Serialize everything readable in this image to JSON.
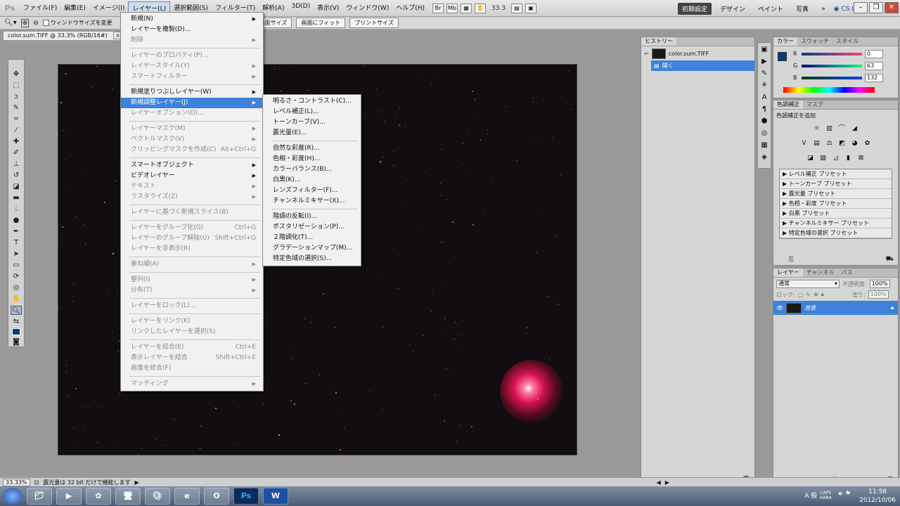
{
  "app": {
    "logo": "Ps",
    "menus": [
      "ファイル(F)",
      "編集(E)",
      "イメージ(I)",
      "レイヤー(L)",
      "選択範囲(S)",
      "フィルター(T)",
      "解析(A)",
      "3D(D)",
      "表示(V)",
      "ウィンドウ(W)",
      "ヘルプ(H)"
    ],
    "active_menu_index": 3,
    "menubar_icons": [
      "Br",
      "Mb"
    ],
    "zoom": "33.3",
    "workspaces": [
      "初期設定",
      "デザイン",
      "ペイント",
      "写真"
    ],
    "more": "»",
    "cs_live": "CS Live"
  },
  "options_bar": {
    "checkbox1": "ウィンドウサイズを変更",
    "buttons": [
      "画面サイズ",
      "画面にフィット",
      "プリントサイズ"
    ]
  },
  "document": {
    "tab_title": "color.sum.TIFF @ 33.3% (RGB/16#)",
    "close": "×"
  },
  "layer_menu": {
    "items": [
      {
        "label": "新規(N)",
        "shortcut": "",
        "submenu": true,
        "disabled": false
      },
      {
        "label": "レイヤーを複製(D)...",
        "shortcut": "",
        "submenu": false,
        "disabled": false
      },
      {
        "label": "削除",
        "shortcut": "",
        "submenu": true,
        "disabled": true
      },
      {
        "sep": true
      },
      {
        "label": "レイヤーのプロパティ(P)...",
        "shortcut": "",
        "submenu": false,
        "disabled": true
      },
      {
        "label": "レイヤースタイル(Y)",
        "shortcut": "",
        "submenu": true,
        "disabled": true
      },
      {
        "label": "スマートフィルター",
        "shortcut": "",
        "submenu": true,
        "disabled": true
      },
      {
        "sep": true
      },
      {
        "label": "新規塗りつぶしレイヤー(W)",
        "shortcut": "",
        "submenu": true,
        "disabled": false
      },
      {
        "label": "新規調整レイヤー(J)",
        "shortcut": "",
        "submenu": true,
        "disabled": false,
        "highlight": true
      },
      {
        "label": "レイヤーオプション(O)...",
        "shortcut": "",
        "submenu": false,
        "disabled": true
      },
      {
        "sep": true
      },
      {
        "label": "レイヤーマスク(M)",
        "shortcut": "",
        "submenu": true,
        "disabled": true
      },
      {
        "label": "ベクトルマスク(V)",
        "shortcut": "",
        "submenu": true,
        "disabled": true
      },
      {
        "label": "クリッピングマスクを作成(C)",
        "shortcut": "Alt+Ctrl+G",
        "submenu": false,
        "disabled": true
      },
      {
        "sep": true
      },
      {
        "label": "スマートオブジェクト",
        "shortcut": "",
        "submenu": true,
        "disabled": false
      },
      {
        "label": "ビデオレイヤー",
        "shortcut": "",
        "submenu": true,
        "disabled": false
      },
      {
        "label": "テキスト",
        "shortcut": "",
        "submenu": true,
        "disabled": true
      },
      {
        "label": "ラスタライズ(Z)",
        "shortcut": "",
        "submenu": true,
        "disabled": true
      },
      {
        "sep": true
      },
      {
        "label": "レイヤーに基づく新規スライス(B)",
        "shortcut": "",
        "submenu": false,
        "disabled": true
      },
      {
        "sep": true
      },
      {
        "label": "レイヤーをグループ化(G)",
        "shortcut": "Ctrl+G",
        "submenu": false,
        "disabled": true
      },
      {
        "label": "レイヤーのグループ解除(U)",
        "shortcut": "Shift+Ctrl+G",
        "submenu": false,
        "disabled": true
      },
      {
        "label": "レイヤーを非表示(R)",
        "shortcut": "",
        "submenu": false,
        "disabled": true
      },
      {
        "sep": true
      },
      {
        "label": "重ね順(A)",
        "shortcut": "",
        "submenu": true,
        "disabled": true
      },
      {
        "sep": true
      },
      {
        "label": "整列(I)",
        "shortcut": "",
        "submenu": true,
        "disabled": true
      },
      {
        "label": "分布(T)",
        "shortcut": "",
        "submenu": true,
        "disabled": true
      },
      {
        "sep": true
      },
      {
        "label": "レイヤーをロック(L)...",
        "shortcut": "",
        "submenu": false,
        "disabled": true
      },
      {
        "sep": true
      },
      {
        "label": "レイヤーをリンク(K)",
        "shortcut": "",
        "submenu": false,
        "disabled": true
      },
      {
        "label": "リンクしたレイヤーを選択(S)",
        "shortcut": "",
        "submenu": false,
        "disabled": true
      },
      {
        "sep": true
      },
      {
        "label": "レイヤーを結合(E)",
        "shortcut": "Ctrl+E",
        "submenu": false,
        "disabled": true
      },
      {
        "label": "表示レイヤーを結合",
        "shortcut": "Shift+Ctrl+E",
        "submenu": false,
        "disabled": true
      },
      {
        "label": "画像を統合(F)",
        "shortcut": "",
        "submenu": false,
        "disabled": true
      },
      {
        "sep": true
      },
      {
        "label": "マッティング",
        "shortcut": "",
        "submenu": true,
        "disabled": true
      }
    ]
  },
  "adjust_submenu": {
    "items": [
      {
        "label": "明るさ・コントラスト(C)..."
      },
      {
        "label": "レベル補正(L)..."
      },
      {
        "label": "トーンカーブ(V)..."
      },
      {
        "label": "露光量(E)..."
      },
      {
        "sep": true
      },
      {
        "label": "自然な彩度(R)..."
      },
      {
        "label": "色相・彩度(H)..."
      },
      {
        "label": "カラーバランス(B)..."
      },
      {
        "label": "白黒(K)..."
      },
      {
        "label": "レンズフィルター(F)..."
      },
      {
        "label": "チャンネルミキサー(X)..."
      },
      {
        "sep": true
      },
      {
        "label": "階調の反転(I)..."
      },
      {
        "label": "ポスタリゼーション(P)..."
      },
      {
        "label": "２階調化(T)..."
      },
      {
        "label": "グラデーションマップ(M)..."
      },
      {
        "label": "特定色域の選択(S)..."
      }
    ]
  },
  "history": {
    "tab": "ヒストリー",
    "snapshot": "color.sum.TIFF",
    "state": "開く"
  },
  "color_panel": {
    "tabs": [
      "カラー",
      "スウォッチ",
      "スタイル"
    ],
    "fg_color": "#0b3b7a",
    "r_label": "R",
    "r_value": "0",
    "g_label": "G",
    "g_value": "63",
    "b_label": "B",
    "b_value": "132"
  },
  "adjust_panel": {
    "tabs": [
      "色調補正",
      "マスク"
    ],
    "heading": "色調補正を追加",
    "presets": [
      "レベル補正 プリセット",
      "トーンカーブ プリセット",
      "露光量 プリセット",
      "色相・彩度 プリセット",
      "白黒 プリセット",
      "チャンネルミキサー プリセット",
      "特定色域の選択 プリセット"
    ]
  },
  "layers_panel": {
    "tabs": [
      "レイヤー",
      "チャンネル",
      "パス"
    ],
    "blend_mode": "通常",
    "opacity_label": "不透明度:",
    "opacity": "100%",
    "lock_label": "ロック:",
    "fill_label": "塗り:",
    "fill": "100%",
    "layer_name": "背景"
  },
  "status": {
    "zoom": "33.33%",
    "message": "露光量は 32 bit だけで機能します"
  },
  "taskbar": {
    "apps": [
      "Ps",
      "W"
    ],
    "time": "11:58",
    "date": "2012/10/06",
    "ime": "A 般",
    "caps": "CAPS KANA"
  }
}
